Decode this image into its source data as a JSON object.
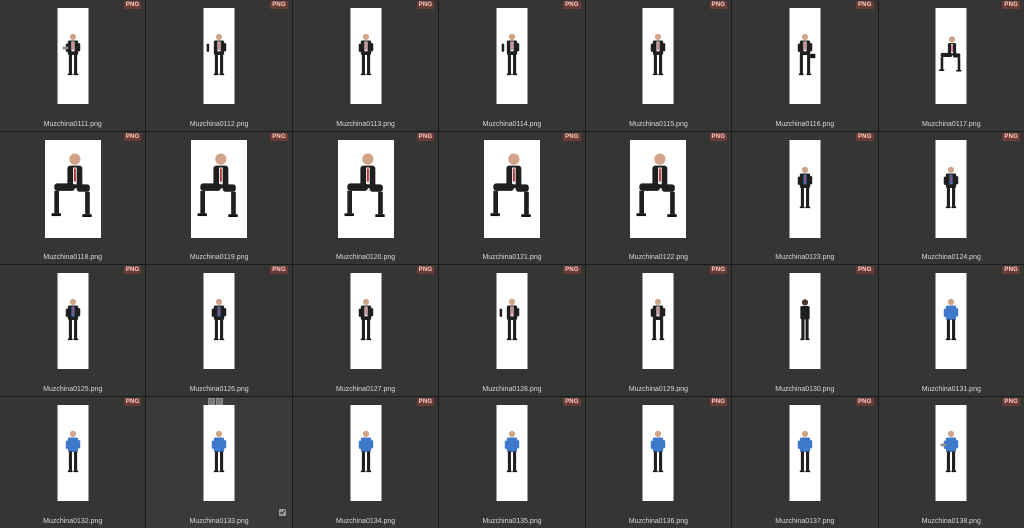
{
  "viewer": {
    "items": [
      {
        "file": "Muzchina0111.png",
        "badge": "PNG",
        "pose": "stand-laptop"
      },
      {
        "file": "Muzchina0112.png",
        "badge": "PNG",
        "pose": "stand-point"
      },
      {
        "file": "Muzchina0113.png",
        "badge": "PNG",
        "pose": "stand-side"
      },
      {
        "file": "Muzchina0114.png",
        "badge": "PNG",
        "pose": "stand-wave"
      },
      {
        "file": "Muzchina0115.png",
        "badge": "PNG",
        "pose": "stand-side"
      },
      {
        "file": "Muzchina0116.png",
        "badge": "PNG",
        "pose": "walk-briefcase"
      },
      {
        "file": "Muzchina0117.png",
        "badge": "PNG",
        "pose": "sit-front"
      },
      {
        "file": "Muzchina0118.png",
        "badge": "PNG",
        "pose": "sit-front"
      },
      {
        "file": "Muzchina0119.png",
        "badge": "PNG",
        "pose": "sit-side"
      },
      {
        "file": "Muzchina0120.png",
        "badge": "PNG",
        "pose": "sit-side"
      },
      {
        "file": "Muzchina0121.png",
        "badge": "PNG",
        "pose": "sit-side"
      },
      {
        "file": "Muzchina0122.png",
        "badge": "PNG",
        "pose": "sit-front"
      },
      {
        "file": "Muzchina0123.png",
        "badge": "PNG",
        "pose": "stand-blue"
      },
      {
        "file": "Muzchina0124.png",
        "badge": "PNG",
        "pose": "stand-blue"
      },
      {
        "file": "Muzchina0125.png",
        "badge": "PNG",
        "pose": "stand-blue"
      },
      {
        "file": "Muzchina0126.png",
        "badge": "PNG",
        "pose": "stand-blue"
      },
      {
        "file": "Muzchina0127.png",
        "badge": "PNG",
        "pose": "stand-side"
      },
      {
        "file": "Muzchina0128.png",
        "badge": "PNG",
        "pose": "stand-point"
      },
      {
        "file": "Muzchina0129.png",
        "badge": "PNG",
        "pose": "walk"
      },
      {
        "file": "Muzchina0130.png",
        "badge": "PNG",
        "pose": "back"
      },
      {
        "file": "Muzchina0131.png",
        "badge": "PNG",
        "pose": "shirt-front"
      },
      {
        "file": "Muzchina0132.png",
        "badge": "PNG",
        "pose": "shirt-front"
      },
      {
        "file": "Muzchina0133.png",
        "badge": "",
        "pose": "shirt-front",
        "selected": true
      },
      {
        "file": "Muzchina0134.png",
        "badge": "PNG",
        "pose": "shirt-front"
      },
      {
        "file": "Muzchina0135.png",
        "badge": "PNG",
        "pose": "shirt-front"
      },
      {
        "file": "Muzchina0136.png",
        "badge": "PNG",
        "pose": "shirt-front"
      },
      {
        "file": "Muzchina0137.png",
        "badge": "PNG",
        "pose": "shirt-front"
      },
      {
        "file": "Muzchina0138.png",
        "badge": "PNG",
        "pose": "shirt-laptop"
      }
    ]
  },
  "colors": {
    "cell_bg": "#353535",
    "grid_line": "#1b1b1b",
    "suit": "#1f1f1f",
    "shirt_blue": "#3f79c9",
    "tie": "#b63239",
    "skin": "#d2a487"
  }
}
